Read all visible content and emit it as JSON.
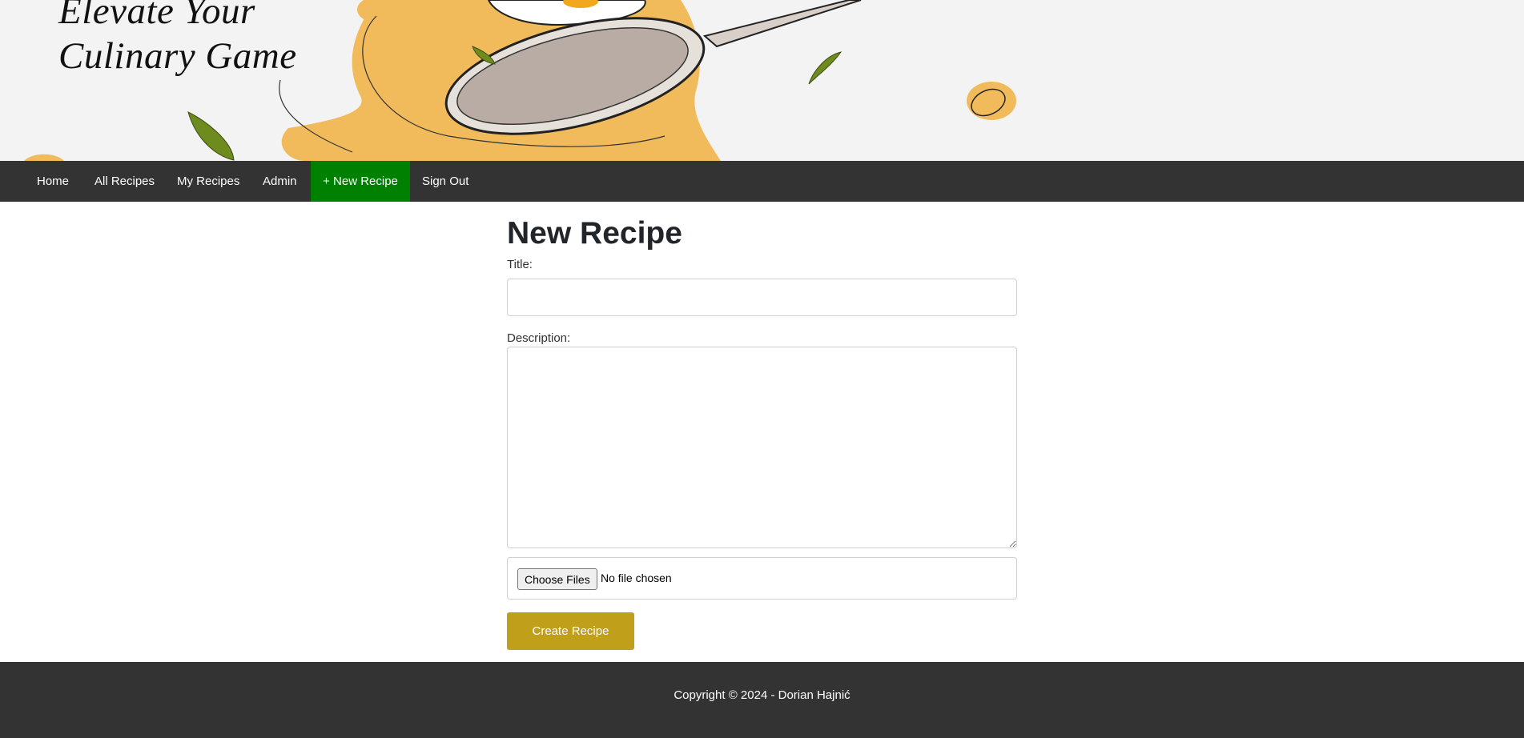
{
  "hero": {
    "title_line1": "Elevate Your",
    "title_line2": "Culinary Game"
  },
  "nav": {
    "items": [
      {
        "label": "Home"
      },
      {
        "label": "All Recipes"
      },
      {
        "label": "My Recipes"
      },
      {
        "label": "Admin"
      },
      {
        "label": "+ New Recipe",
        "active": true
      },
      {
        "label": "Sign Out"
      }
    ],
    "active_color": "#008000",
    "bar_color": "#333333"
  },
  "form": {
    "heading": "New Recipe",
    "title_label": "Title:",
    "title_value": "",
    "description_label": "Description:",
    "description_value": "",
    "file_button_label": "Choose Files",
    "file_status": "No file chosen",
    "submit_label": "Create Recipe",
    "submit_color": "#c09f1a"
  },
  "footer": {
    "text": "Copyright © 2024 - Dorian Hajnić"
  }
}
